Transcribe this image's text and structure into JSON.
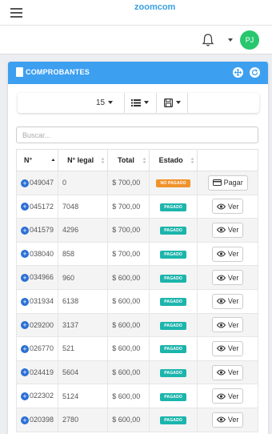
{
  "topbar": {
    "logo_text": "zoomcom",
    "logo_sub": ""
  },
  "user": {
    "initials": "PJ",
    "avatar_color": "#28c76f"
  },
  "panel": {
    "title": "COMPROBANTES",
    "header_color": "#3d9ff0"
  },
  "toolbar": {
    "page_size": "15"
  },
  "search": {
    "placeholder": "Buscar..."
  },
  "table": {
    "columns": [
      "N°",
      "N° legal",
      "Total",
      "Estado"
    ],
    "rows": [
      {
        "id": "049047",
        "legal": "0",
        "total": "$ 700,00",
        "status": "NO PAGADO",
        "status_color": "#f0932b",
        "action": "Pagar",
        "action_icon": "card-icon"
      },
      {
        "id": "045172",
        "legal": "7048",
        "total": "$ 700,00",
        "status": "PAGADO",
        "status_color": "#1cb5ac",
        "action": "Ver",
        "action_icon": "eye-icon"
      },
      {
        "id": "041579",
        "legal": "4296",
        "total": "$ 700,00",
        "status": "PAGADO",
        "status_color": "#1cb5ac",
        "action": "Ver",
        "action_icon": "eye-icon"
      },
      {
        "id": "038040",
        "legal": "858",
        "total": "$ 700,00",
        "status": "PAGADO",
        "status_color": "#1cb5ac",
        "action": "Ver",
        "action_icon": "eye-icon"
      },
      {
        "id": "034966",
        "legal": "960",
        "total": "$ 600,00",
        "status": "PAGADO",
        "status_color": "#1cb5ac",
        "action": "Ver",
        "action_icon": "eye-icon"
      },
      {
        "id": "031934",
        "legal": "6138",
        "total": "$ 600,00",
        "status": "PAGADO",
        "status_color": "#1cb5ac",
        "action": "Ver",
        "action_icon": "eye-icon"
      },
      {
        "id": "029200",
        "legal": "3137",
        "total": "$ 600,00",
        "status": "PAGADO",
        "status_color": "#1cb5ac",
        "action": "Ver",
        "action_icon": "eye-icon"
      },
      {
        "id": "026770",
        "legal": "521",
        "total": "$ 600,00",
        "status": "PAGADO",
        "status_color": "#1cb5ac",
        "action": "Ver",
        "action_icon": "eye-icon"
      },
      {
        "id": "024419",
        "legal": "5604",
        "total": "$ 600,00",
        "status": "PAGADO",
        "status_color": "#1cb5ac",
        "action": "Ver",
        "action_icon": "eye-icon"
      },
      {
        "id": "022302",
        "legal": "5124",
        "total": "$ 600,00",
        "status": "PAGADO",
        "status_color": "#1cb5ac",
        "action": "Ver",
        "action_icon": "eye-icon"
      },
      {
        "id": "020398",
        "legal": "2780",
        "total": "$ 600,00",
        "status": "PAGADO",
        "status_color": "#1cb5ac",
        "action": "Ver",
        "action_icon": "eye-icon"
      }
    ]
  }
}
